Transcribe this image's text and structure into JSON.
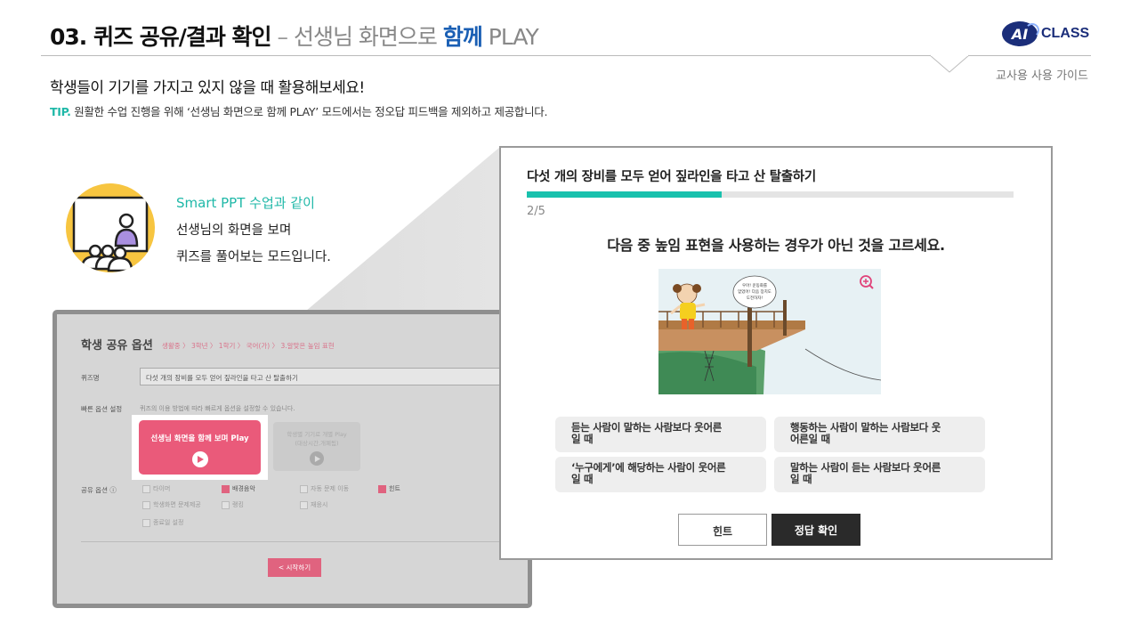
{
  "header": {
    "title_main": "03. 퀴즈 공유/결과 확인",
    "title_dash": " – ",
    "title_sub": "선생님 화면으로 ",
    "title_accent": "함께",
    "title_play": " PLAY",
    "logo_ai": "AI",
    "logo_class": "CLASS",
    "guide": "교사용 사용 가이드"
  },
  "intro": "학생들이 기기를 가지고 있지 않을 때 활용해보세요!",
  "tip": {
    "label": "TIP.",
    "text": " 원활한 수업 진행을 위해 ‘선생님 화면으로 함께 PLAY’ 모드에서는 정오답 피드백을 제외하고 제공합니다."
  },
  "mode": {
    "title": "Smart PPT 수업과 같이",
    "line1": "선생님의 화면을 보며",
    "line2": "퀴즈를 풀어보는 모드입니다."
  },
  "settings": {
    "title": "학생 공유 옵션",
    "breadcrumb": "생활중 〉 3학년 〉 1학기 〉 국어(가) 〉 3.알맞은 높임 표현",
    "quiz_name_label": "퀴즈명",
    "quiz_name_value": "다섯 개의 장비를 모두 얻어 짚라인을 타고 산 탈출하기",
    "quick_label": "빠른 옵션 설정",
    "quick_hint": "퀴즈의 이용 방법에 따라 빠르게 옵션을 설정할 수 있습니다.",
    "teacher_play": "선생님 화면을 함께 보며 Play",
    "student_play_1": "학생별 기기로 개별 Play",
    "student_play_2": "(대상시간,개폐됨)",
    "share_label": "공유 옵션 ⓘ",
    "options": [
      {
        "label": "타이머",
        "checked": false
      },
      {
        "label": "배경음악",
        "checked": true
      },
      {
        "label": "자동 문제 이동",
        "checked": false
      },
      {
        "label": "힌트",
        "checked": true
      },
      {
        "label": "학생화면 문제제공",
        "checked": false
      },
      {
        "label": "랭킹",
        "checked": false
      },
      {
        "label": "재응시",
        "checked": false
      },
      {
        "label": "종료일 설정",
        "checked": false
      }
    ],
    "start": "< 시작하기"
  },
  "quiz": {
    "title": "다섯 개의 장비를 모두 얻어 짚라인을 타고 산 탈출하기",
    "progress": 0.4,
    "step": "2/5",
    "question": "다음 중 높임 표현을 사용하는 경우가 아닌 것을 고르세요.",
    "speech": [
      "우아! 운동화를",
      "얻었어! 다음 장치도",
      "도전하자!"
    ],
    "answers": [
      [
        "듣는 사람이 말하는 사람보다 웃어른",
        "일 때"
      ],
      [
        "행동하는 사람이 말하는 사람보다 웃",
        "어른일 때"
      ],
      [
        "‘누구에게’에 해당하는 사람이 웃어른",
        "일 때"
      ],
      [
        "말하는 사람이 듣는 사람보다 웃어른",
        "일 때"
      ]
    ],
    "hint_button": "힌트",
    "check_button": "정답 확인"
  },
  "colors": {
    "accent_teal": "#19c1ad",
    "accent_blue": "#1a5fb4",
    "pink": "#ea5a7a",
    "dark_button": "#2a2a2a",
    "illus_yellow": "#f7c540"
  }
}
